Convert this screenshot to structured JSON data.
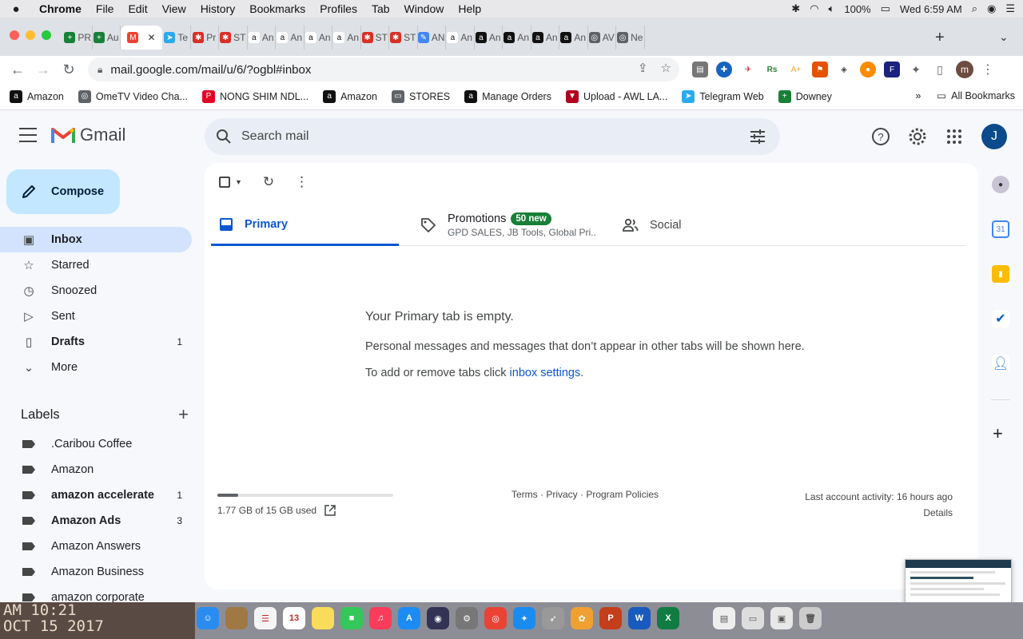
{
  "menubar": {
    "apple": "",
    "items": [
      "Chrome",
      "File",
      "Edit",
      "View",
      "History",
      "Bookmarks",
      "Profiles",
      "Tab",
      "Window",
      "Help"
    ],
    "battery": "100%",
    "clock": "Wed 6:59 AM"
  },
  "tabs": [
    {
      "label": "PR",
      "fav_color": "#188038",
      "fav_glyph": "+"
    },
    {
      "label": "Au",
      "fav_color": "#188038",
      "fav_glyph": "+"
    },
    {
      "label": "",
      "fav_color": "#ea4335",
      "fav_glyph": "M",
      "active": true
    },
    {
      "label": "Te",
      "fav_color": "#2aabee",
      "fav_glyph": "➤"
    },
    {
      "label": "Pr",
      "fav_color": "#d93025",
      "fav_glyph": "✱"
    },
    {
      "label": "ST",
      "fav_color": "#d93025",
      "fav_glyph": "✱"
    },
    {
      "label": "An",
      "fav_color": "#ffffff",
      "fav_glyph": "a"
    },
    {
      "label": "An",
      "fav_color": "#ffffff",
      "fav_glyph": "a"
    },
    {
      "label": "An",
      "fav_color": "#ffffff",
      "fav_glyph": "a"
    },
    {
      "label": "An",
      "fav_color": "#ffffff",
      "fav_glyph": "a"
    },
    {
      "label": "ST",
      "fav_color": "#d93025",
      "fav_glyph": "✱"
    },
    {
      "label": "ST",
      "fav_color": "#d93025",
      "fav_glyph": "✱"
    },
    {
      "label": "AN",
      "fav_color": "#4285f4",
      "fav_glyph": "✎"
    },
    {
      "label": "An",
      "fav_color": "#ffffff",
      "fav_glyph": "a"
    },
    {
      "label": "An",
      "fav_color": "#111111",
      "fav_glyph": "a"
    },
    {
      "label": "An",
      "fav_color": "#111111",
      "fav_glyph": "a"
    },
    {
      "label": "An",
      "fav_color": "#111111",
      "fav_glyph": "a"
    },
    {
      "label": "An",
      "fav_color": "#111111",
      "fav_glyph": "a"
    },
    {
      "label": "AV",
      "fav_color": "#5f6368",
      "fav_glyph": "◎"
    },
    {
      "label": "Ne",
      "fav_color": "#5f6368",
      "fav_glyph": "◎"
    }
  ],
  "toolbar": {
    "url": "mail.google.com/mail/u/6/?ogbl#inbox",
    "profile_initial": "m"
  },
  "bookmarks": [
    {
      "label": "Amazon",
      "fav_color": "#111111",
      "fav_glyph": "a"
    },
    {
      "label": "OmeTV Video Cha...",
      "fav_color": "#5f6368",
      "fav_glyph": "◎"
    },
    {
      "label": "NONG SHIM NDL...",
      "fav_color": "#e60023",
      "fav_glyph": "P"
    },
    {
      "label": "Amazon",
      "fav_color": "#111111",
      "fav_glyph": "a"
    },
    {
      "label": "STORES",
      "fav_color": "#5f6368",
      "fav_glyph": "▭"
    },
    {
      "label": "Manage Orders",
      "fav_color": "#111111",
      "fav_glyph": "a"
    },
    {
      "label": "Upload - AWL LA...",
      "fav_color": "#b00020",
      "fav_glyph": "▼"
    },
    {
      "label": "Telegram Web",
      "fav_color": "#2aabee",
      "fav_glyph": "➤"
    },
    {
      "label": "Downey",
      "fav_color": "#188038",
      "fav_glyph": "+"
    }
  ],
  "bookmarks_more": "»",
  "all_bookmarks": "All Bookmarks",
  "gmail": {
    "logo_text": "Gmail",
    "search_placeholder": "Search mail",
    "avatar_initial": "J",
    "compose": "Compose",
    "nav": [
      {
        "label": "Inbox",
        "icon": "inbox-icon",
        "glyph": "▣",
        "active": true,
        "bold": true,
        "count": ""
      },
      {
        "label": "Starred",
        "icon": "star-icon",
        "glyph": "☆",
        "count": ""
      },
      {
        "label": "Snoozed",
        "icon": "clock-icon",
        "glyph": "◷",
        "count": ""
      },
      {
        "label": "Sent",
        "icon": "send-icon",
        "glyph": "▷",
        "count": ""
      },
      {
        "label": "Drafts",
        "icon": "draft-icon",
        "glyph": "▯",
        "bold": true,
        "count": "1"
      },
      {
        "label": "More",
        "icon": "chevron-down-icon",
        "glyph": "⌄",
        "count": ""
      }
    ],
    "labels_title": "Labels",
    "labels": [
      {
        "label": ".Caribou Coffee",
        "count": ""
      },
      {
        "label": "Amazon",
        "count": ""
      },
      {
        "label": "amazon accelerate",
        "bold": true,
        "count": "1"
      },
      {
        "label": "Amazon Ads",
        "bold": true,
        "count": "3"
      },
      {
        "label": "Amazon Answers",
        "count": ""
      },
      {
        "label": "Amazon Business",
        "count": ""
      },
      {
        "label": "amazon corporate",
        "count": ""
      }
    ],
    "tabs": {
      "primary": "Primary",
      "promotions": "Promotions",
      "promotions_badge": "50 new",
      "promotions_senders": "GPD SALES, JB Tools, Global Pri...",
      "social": "Social"
    },
    "empty": {
      "title": "Your Primary tab is empty.",
      "text": "Personal messages and messages that don’t appear in other tabs will be shown here.",
      "link_prefix": "To add or remove tabs click ",
      "link": "inbox settings",
      "link_suffix": "."
    },
    "footer": {
      "storage": "1.77 GB of 15 GB used",
      "storage_fraction": 0.118,
      "policies": "Terms · Privacy · Program Policies",
      "activity": "Last account activity: 16 hours ago",
      "details": "Details"
    }
  },
  "dock_photo_text": [
    "AM 10:21",
    "OCT 15 2017"
  ],
  "dock_apps": [
    {
      "name": "finder",
      "color": "#2a8cf0",
      "glyph": "☺"
    },
    {
      "name": "notes-brown",
      "color": "#a07844",
      "glyph": ""
    },
    {
      "name": "reminders",
      "color": "#f5f5f5",
      "glyph": "☰"
    },
    {
      "name": "calendar",
      "color": "#ffffff",
      "glyph": "13"
    },
    {
      "name": "notes",
      "color": "#f8dc5a",
      "glyph": ""
    },
    {
      "name": "facetime",
      "color": "#34c759",
      "glyph": "■"
    },
    {
      "name": "music",
      "color": "#fa3c5a",
      "glyph": "♫"
    },
    {
      "name": "app-store",
      "color": "#1c8cf4",
      "glyph": "A"
    },
    {
      "name": "siri",
      "color": "#333355",
      "glyph": "◉"
    },
    {
      "name": "system-preferences",
      "color": "#777777",
      "glyph": "⚙"
    },
    {
      "name": "chrome",
      "color": "#ea4335",
      "glyph": "◎"
    },
    {
      "name": "safari",
      "color": "#1a8cf0",
      "glyph": "✦"
    },
    {
      "name": "launchpad",
      "color": "#999999",
      "glyph": "➶"
    },
    {
      "name": "photos",
      "color": "#f0a030",
      "glyph": "✿"
    },
    {
      "name": "powerpoint",
      "color": "#c43e1c",
      "glyph": "P"
    },
    {
      "name": "word",
      "color": "#185abd",
      "glyph": "W"
    },
    {
      "name": "excel",
      "color": "#107c41",
      "glyph": "X"
    }
  ],
  "colors": {
    "accent": "#0b57d0",
    "compose_bg": "#c2e7ff",
    "active_nav_bg": "#d3e3fd",
    "badge_green": "#188038"
  }
}
